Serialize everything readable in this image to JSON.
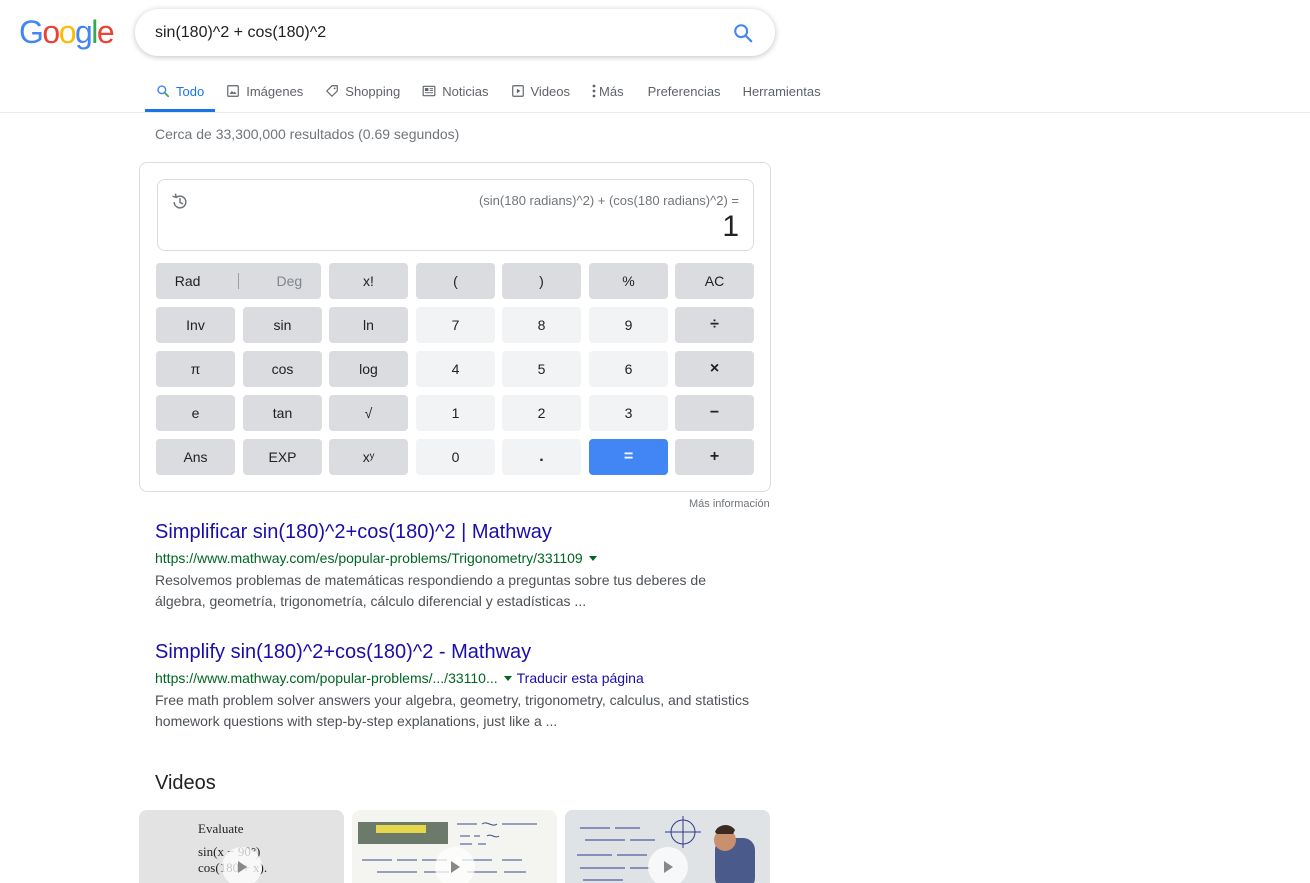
{
  "logo": {
    "letters": [
      "G",
      "o",
      "o",
      "g",
      "l",
      "e"
    ],
    "colors": [
      "#4285f4",
      "#ea4335",
      "#fbbc05",
      "#4285f4",
      "#34a853",
      "#ea4335"
    ]
  },
  "search": {
    "query": "sin(180)^2 + cos(180)^2",
    "icon": "search-icon"
  },
  "tabs": [
    {
      "label": "Todo",
      "icon": "search-icon",
      "active": true
    },
    {
      "label": "Imágenes",
      "icon": "image-icon"
    },
    {
      "label": "Shopping",
      "icon": "tag-icon"
    },
    {
      "label": "Noticias",
      "icon": "news-icon"
    },
    {
      "label": "Videos",
      "icon": "video-icon"
    },
    {
      "label": "Más",
      "icon": "more-vert-icon"
    },
    {
      "label": "Preferencias"
    },
    {
      "label": "Herramientas"
    }
  ],
  "stats": "Cerca de 33,300,000 resultados (0.69 segundos)",
  "calculator": {
    "expression": "(sin(180 radians)^2) + (cos(180 radians)^2) =",
    "result": "1",
    "rad": "Rad",
    "deg": "Deg",
    "keys": [
      "x!",
      "(",
      ")",
      "%",
      "AC",
      "Inv",
      "sin",
      "ln",
      "7",
      "8",
      "9",
      "÷",
      "π",
      "cos",
      "log",
      "4",
      "5",
      "6",
      "×",
      "e",
      "tan",
      "√",
      "1",
      "2",
      "3",
      "−",
      "Ans",
      "EXP",
      "xʸ",
      "0",
      ".",
      "=",
      "+"
    ],
    "more_info": "Más información"
  },
  "results": [
    {
      "title": "Simplificar sin(180)^2+cos(180)^2 | Mathway",
      "url": "https://www.mathway.com/es/popular-problems/Trigonometry/331109",
      "snippet_1": "Resolvemos problemas de matemáticas respondiendo a preguntas sobre tus deberes de",
      "snippet_2": "álgebra, geometría, trigonometría, cálculo diferencial y estadísticas ..."
    },
    {
      "title": "Simplify sin(180)^2+cos(180)^2 - Mathway",
      "url": "https://www.mathway.com/popular-problems/.../33110...",
      "translate": "Traducir esta página",
      "snippet_1": "Free math problem solver answers your algebra, geometry, trigonometry, calculus, and statistics",
      "snippet_2": "homework questions with step-by-step explanations, just like a ..."
    }
  ],
  "videos": {
    "heading": "Videos",
    "card1": {
      "line1": "Evaluate",
      "line2": "sin(x − 90°)",
      "line3": "cos(180 + x)."
    }
  }
}
